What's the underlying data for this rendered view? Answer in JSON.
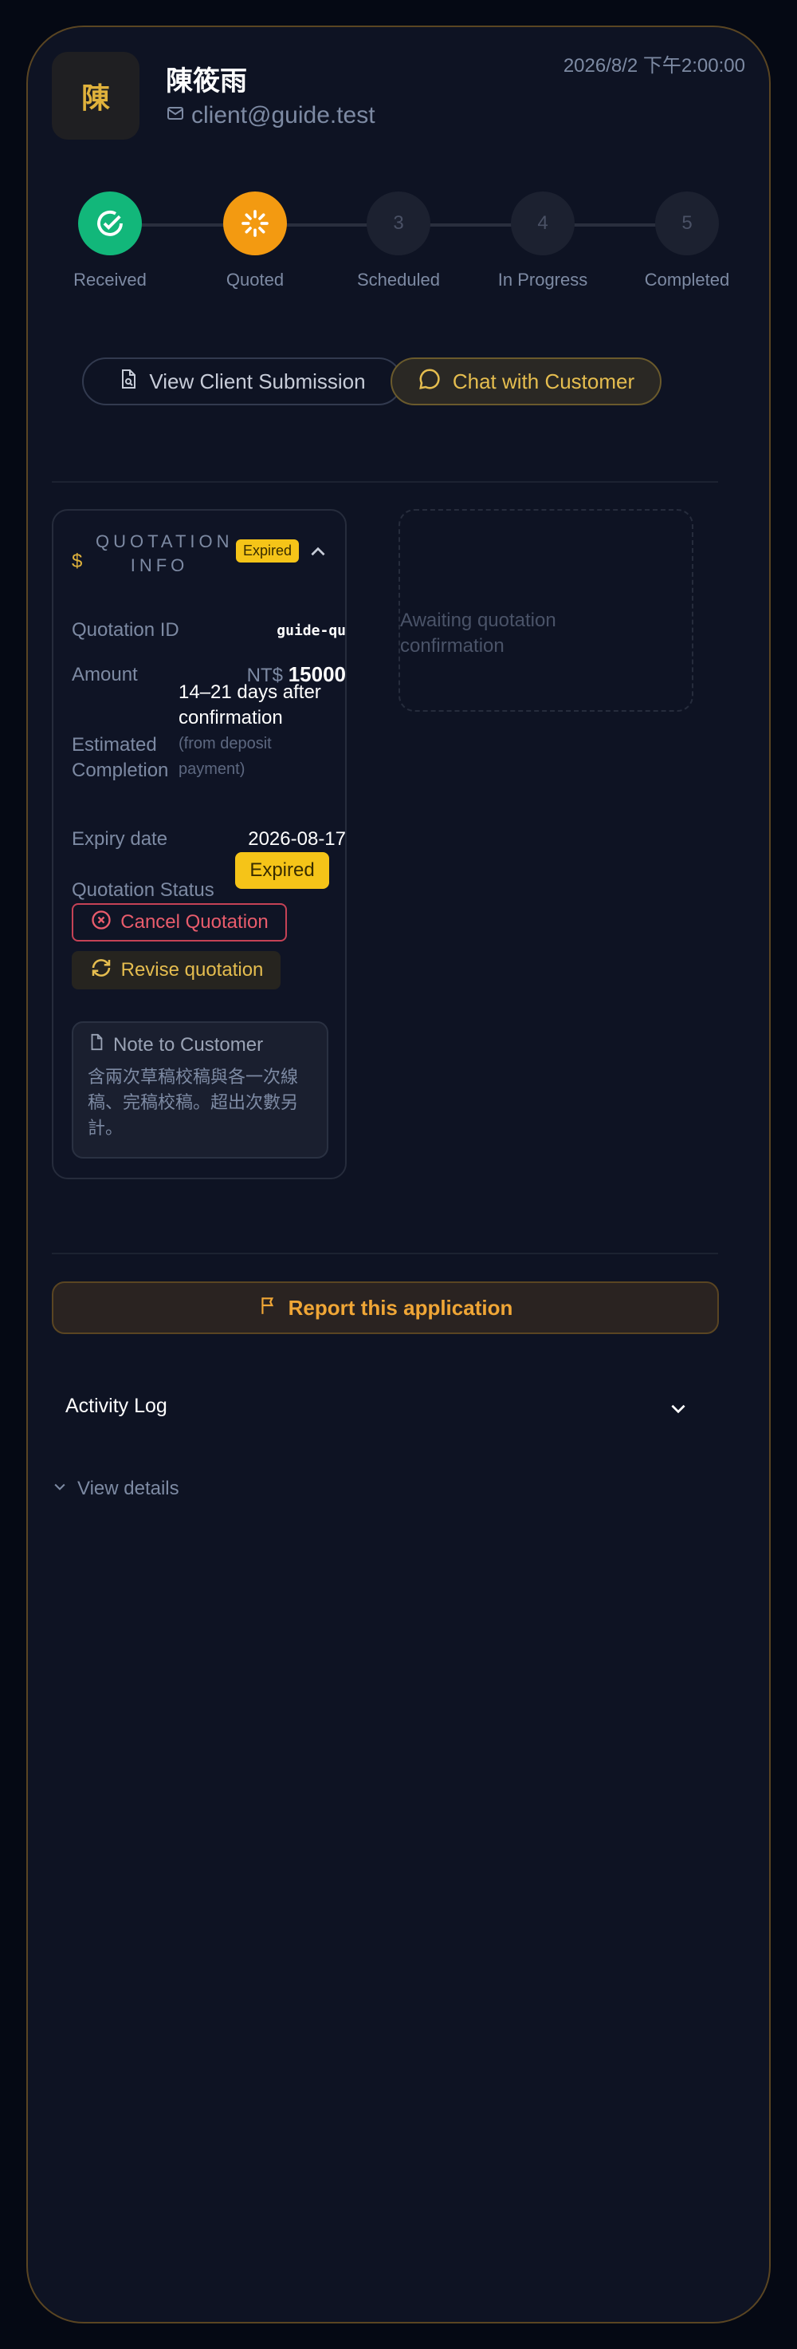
{
  "client": {
    "avatar_initial": "陳",
    "name": "陳筱雨",
    "email": "client@guide.test",
    "datetime": "2026/8/2 下午2:00:00"
  },
  "steps": [
    {
      "num": "",
      "label": "Received",
      "state": "done"
    },
    {
      "num": "",
      "label": "Quoted",
      "state": "active"
    },
    {
      "num": "3",
      "label": "Scheduled",
      "state": "pending"
    },
    {
      "num": "4",
      "label": "In Progress",
      "state": "pending"
    },
    {
      "num": "5",
      "label": "Completed",
      "state": "pending"
    }
  ],
  "actions": {
    "view_submission": "View Client Submission",
    "chat": "Chat with Customer"
  },
  "quotation": {
    "title": "QUOTATION INFO",
    "header_badge": "Expired",
    "id_label": "Quotation ID",
    "id_value": "guide-qu",
    "amount_label": "Amount",
    "amount_currency": "NT$",
    "amount_value": "15000",
    "est_label": "Estimated Completion",
    "est_value": "14–21 days after confirmation",
    "est_sub": "(from deposit payment)",
    "expiry_label": "Expiry date",
    "expiry_value": "2026-08-17",
    "status_label": "Quotation Status",
    "status_value": "Expired",
    "cancel_label": "Cancel Quotation",
    "revise_label": "Revise quotation",
    "note_title": "Note to Customer",
    "note_text": "含兩次草稿校稿與各一次線稿、完稿校稿。超出次數另計。"
  },
  "awaiting": "Awaiting quotation confirmation",
  "report": "Report this application",
  "activity_log": "Activity Log",
  "view_details": "View details",
  "colors": {
    "accent_gold": "#e5bd4f",
    "success": "#12b77a",
    "warning": "#f39a11",
    "danger": "#e95c6c"
  }
}
